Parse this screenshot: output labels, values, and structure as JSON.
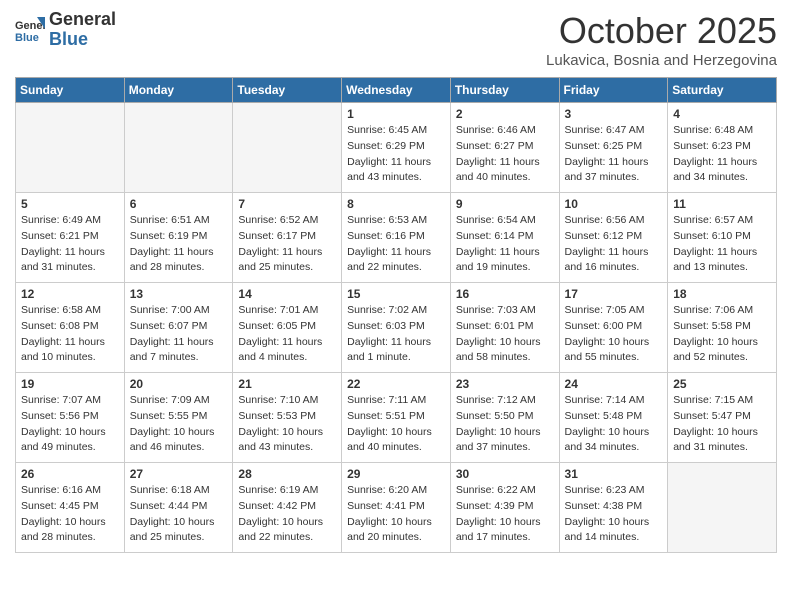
{
  "header": {
    "logo_general": "General",
    "logo_blue": "Blue",
    "month": "October 2025",
    "location": "Lukavica, Bosnia and Herzegovina"
  },
  "days_of_week": [
    "Sunday",
    "Monday",
    "Tuesday",
    "Wednesday",
    "Thursday",
    "Friday",
    "Saturday"
  ],
  "weeks": [
    [
      {
        "num": "",
        "info": ""
      },
      {
        "num": "",
        "info": ""
      },
      {
        "num": "",
        "info": ""
      },
      {
        "num": "1",
        "info": "Sunrise: 6:45 AM\nSunset: 6:29 PM\nDaylight: 11 hours\nand 43 minutes."
      },
      {
        "num": "2",
        "info": "Sunrise: 6:46 AM\nSunset: 6:27 PM\nDaylight: 11 hours\nand 40 minutes."
      },
      {
        "num": "3",
        "info": "Sunrise: 6:47 AM\nSunset: 6:25 PM\nDaylight: 11 hours\nand 37 minutes."
      },
      {
        "num": "4",
        "info": "Sunrise: 6:48 AM\nSunset: 6:23 PM\nDaylight: 11 hours\nand 34 minutes."
      }
    ],
    [
      {
        "num": "5",
        "info": "Sunrise: 6:49 AM\nSunset: 6:21 PM\nDaylight: 11 hours\nand 31 minutes."
      },
      {
        "num": "6",
        "info": "Sunrise: 6:51 AM\nSunset: 6:19 PM\nDaylight: 11 hours\nand 28 minutes."
      },
      {
        "num": "7",
        "info": "Sunrise: 6:52 AM\nSunset: 6:17 PM\nDaylight: 11 hours\nand 25 minutes."
      },
      {
        "num": "8",
        "info": "Sunrise: 6:53 AM\nSunset: 6:16 PM\nDaylight: 11 hours\nand 22 minutes."
      },
      {
        "num": "9",
        "info": "Sunrise: 6:54 AM\nSunset: 6:14 PM\nDaylight: 11 hours\nand 19 minutes."
      },
      {
        "num": "10",
        "info": "Sunrise: 6:56 AM\nSunset: 6:12 PM\nDaylight: 11 hours\nand 16 minutes."
      },
      {
        "num": "11",
        "info": "Sunrise: 6:57 AM\nSunset: 6:10 PM\nDaylight: 11 hours\nand 13 minutes."
      }
    ],
    [
      {
        "num": "12",
        "info": "Sunrise: 6:58 AM\nSunset: 6:08 PM\nDaylight: 11 hours\nand 10 minutes."
      },
      {
        "num": "13",
        "info": "Sunrise: 7:00 AM\nSunset: 6:07 PM\nDaylight: 11 hours\nand 7 minutes."
      },
      {
        "num": "14",
        "info": "Sunrise: 7:01 AM\nSunset: 6:05 PM\nDaylight: 11 hours\nand 4 minutes."
      },
      {
        "num": "15",
        "info": "Sunrise: 7:02 AM\nSunset: 6:03 PM\nDaylight: 11 hours\nand 1 minute."
      },
      {
        "num": "16",
        "info": "Sunrise: 7:03 AM\nSunset: 6:01 PM\nDaylight: 10 hours\nand 58 minutes."
      },
      {
        "num": "17",
        "info": "Sunrise: 7:05 AM\nSunset: 6:00 PM\nDaylight: 10 hours\nand 55 minutes."
      },
      {
        "num": "18",
        "info": "Sunrise: 7:06 AM\nSunset: 5:58 PM\nDaylight: 10 hours\nand 52 minutes."
      }
    ],
    [
      {
        "num": "19",
        "info": "Sunrise: 7:07 AM\nSunset: 5:56 PM\nDaylight: 10 hours\nand 49 minutes."
      },
      {
        "num": "20",
        "info": "Sunrise: 7:09 AM\nSunset: 5:55 PM\nDaylight: 10 hours\nand 46 minutes."
      },
      {
        "num": "21",
        "info": "Sunrise: 7:10 AM\nSunset: 5:53 PM\nDaylight: 10 hours\nand 43 minutes."
      },
      {
        "num": "22",
        "info": "Sunrise: 7:11 AM\nSunset: 5:51 PM\nDaylight: 10 hours\nand 40 minutes."
      },
      {
        "num": "23",
        "info": "Sunrise: 7:12 AM\nSunset: 5:50 PM\nDaylight: 10 hours\nand 37 minutes."
      },
      {
        "num": "24",
        "info": "Sunrise: 7:14 AM\nSunset: 5:48 PM\nDaylight: 10 hours\nand 34 minutes."
      },
      {
        "num": "25",
        "info": "Sunrise: 7:15 AM\nSunset: 5:47 PM\nDaylight: 10 hours\nand 31 minutes."
      }
    ],
    [
      {
        "num": "26",
        "info": "Sunrise: 6:16 AM\nSunset: 4:45 PM\nDaylight: 10 hours\nand 28 minutes."
      },
      {
        "num": "27",
        "info": "Sunrise: 6:18 AM\nSunset: 4:44 PM\nDaylight: 10 hours\nand 25 minutes."
      },
      {
        "num": "28",
        "info": "Sunrise: 6:19 AM\nSunset: 4:42 PM\nDaylight: 10 hours\nand 22 minutes."
      },
      {
        "num": "29",
        "info": "Sunrise: 6:20 AM\nSunset: 4:41 PM\nDaylight: 10 hours\nand 20 minutes."
      },
      {
        "num": "30",
        "info": "Sunrise: 6:22 AM\nSunset: 4:39 PM\nDaylight: 10 hours\nand 17 minutes."
      },
      {
        "num": "31",
        "info": "Sunrise: 6:23 AM\nSunset: 4:38 PM\nDaylight: 10 hours\nand 14 minutes."
      },
      {
        "num": "",
        "info": ""
      }
    ]
  ]
}
